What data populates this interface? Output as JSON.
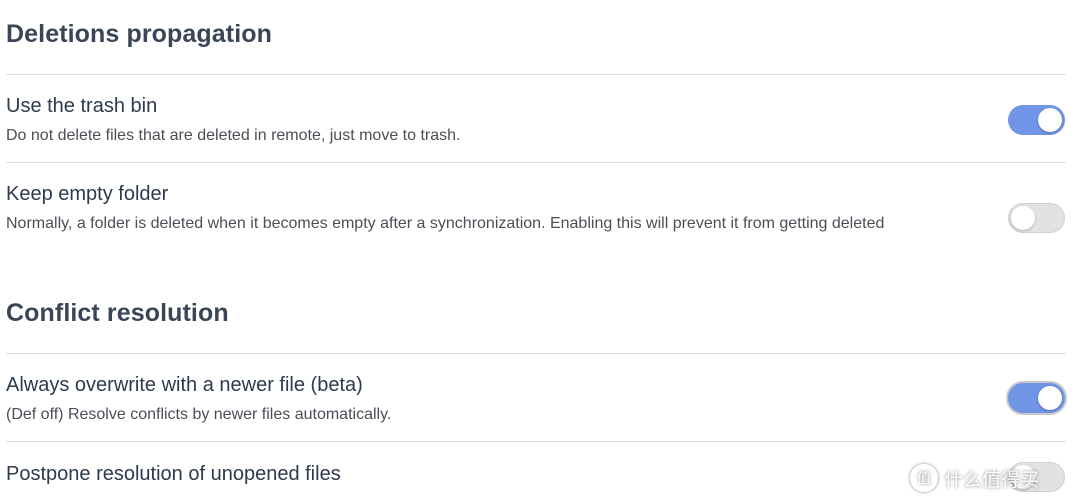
{
  "colors": {
    "toggle_on": "#7094e6",
    "toggle_off": "#e2e2e2",
    "divider": "#dcdcdc",
    "heading": "#3a4658"
  },
  "sections": [
    {
      "heading": "Deletions propagation",
      "settings": [
        {
          "name": "Use the trash bin",
          "description": "Do not delete files that are deleted in remote, just move to trash.",
          "enabled": true
        },
        {
          "name": "Keep empty folder",
          "description": "Normally, a folder is deleted when it becomes empty after a synchronization. Enabling this will prevent it from getting deleted",
          "enabled": false
        }
      ]
    },
    {
      "heading": "Conflict resolution",
      "settings": [
        {
          "name": "Always overwrite with a newer file (beta)",
          "description": "(Def off) Resolve conflicts by newer files automatically.",
          "enabled": true
        },
        {
          "name": "Postpone resolution of unopened files",
          "description": "",
          "enabled": false
        }
      ]
    }
  ],
  "watermark": {
    "icon": "值",
    "text": "什么值得买"
  }
}
